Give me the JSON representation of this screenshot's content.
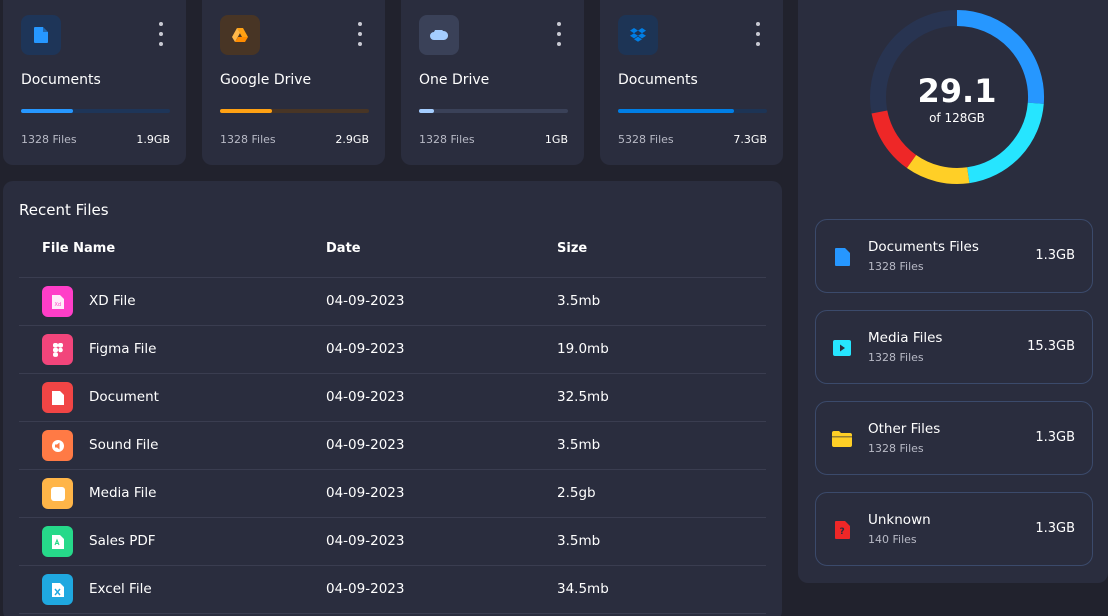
{
  "colors": {
    "background": "#21222d",
    "panel": "#2a2d3e",
    "blue": "#2697ff",
    "orange": "#ffa113",
    "light_blue": "#a4cdff",
    "cyan": "#26e5ff",
    "yellow": "#ffcf26",
    "red": "#ee2727"
  },
  "cards": [
    {
      "title": "Documents",
      "files": "1328 Files",
      "size": "1.9GB",
      "icon": "document-icon",
      "progress": 0.35,
      "color": "#2697ff"
    },
    {
      "title": "Google Drive",
      "files": "1328 Files",
      "size": "2.9GB",
      "icon": "google-drive-icon",
      "progress": 0.35,
      "color": "#ffa113"
    },
    {
      "title": "One Drive",
      "files": "1328 Files",
      "size": "1GB",
      "icon": "onedrive-icon",
      "progress": 0.1,
      "color": "#a4cdff"
    },
    {
      "title": "Documents",
      "files": "5328 Files",
      "size": "7.3GB",
      "icon": "dropbox-icon",
      "progress": 0.78,
      "color": "#007ee5"
    }
  ],
  "recent": {
    "title": "Recent Files",
    "headers": {
      "name": "File Name",
      "date": "Date",
      "size": "Size"
    },
    "rows": [
      {
        "name": "XD File",
        "date": "04-09-2023",
        "size": "3.5mb",
        "icon": "xd-file-icon",
        "color": "#ff3ec8"
      },
      {
        "name": "Figma File",
        "date": "04-09-2023",
        "size": "19.0mb",
        "icon": "figma-file-icon",
        "color": "#f2457b"
      },
      {
        "name": "Document",
        "date": "04-09-2023",
        "size": "32.5mb",
        "icon": "document-file-icon",
        "color": "#f14545"
      },
      {
        "name": "Sound File",
        "date": "04-09-2023",
        "size": "3.5mb",
        "icon": "sound-file-icon",
        "color": "#ff7a45"
      },
      {
        "name": "Media File",
        "date": "04-09-2023",
        "size": "2.5gb",
        "icon": "media-file-icon",
        "color": "#ffb548"
      },
      {
        "name": "Sales PDF",
        "date": "04-09-2023",
        "size": "3.5mb",
        "icon": "pdf-file-icon",
        "color": "#26d98a"
      },
      {
        "name": "Excel File",
        "date": "04-09-2023",
        "size": "34.5mb",
        "icon": "excel-file-icon",
        "color": "#1fa8e0"
      }
    ]
  },
  "storage": {
    "used": "29.1",
    "total": "of 128GB",
    "items": [
      {
        "name": "Documents Files",
        "files": "1328 Files",
        "size": "1.3GB",
        "icon": "document-icon",
        "color": "#2697ff"
      },
      {
        "name": "Media Files",
        "files": "1328 Files",
        "size": "15.3GB",
        "icon": "media-play-icon",
        "color": "#26e5ff"
      },
      {
        "name": "Other Files",
        "files": "1328 Files",
        "size": "1.3GB",
        "icon": "folder-icon",
        "color": "#ffcf26"
      },
      {
        "name": "Unknown",
        "files": "140 Files",
        "size": "1.3GB",
        "icon": "unknown-file-icon",
        "color": "#ee2727"
      }
    ]
  }
}
